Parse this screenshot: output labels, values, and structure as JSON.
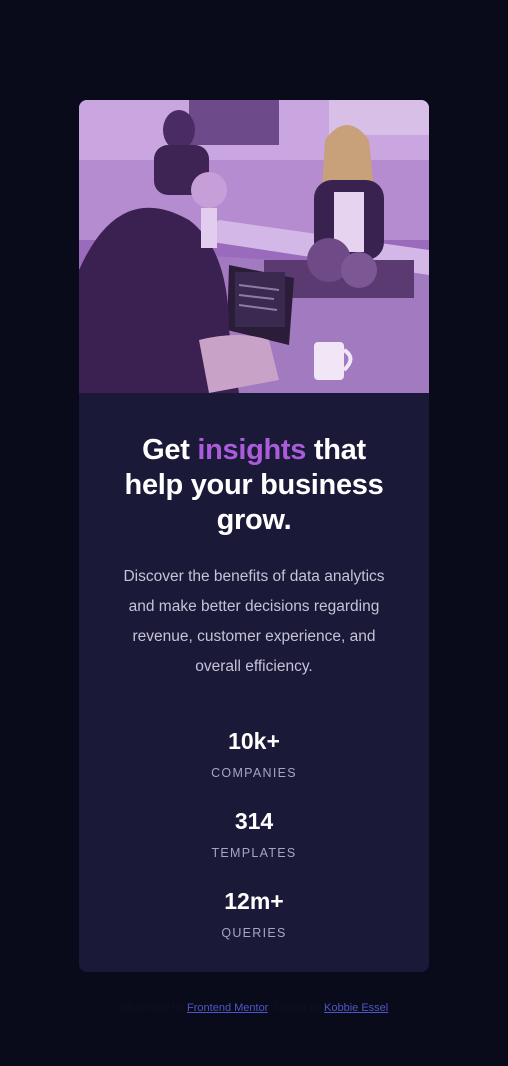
{
  "card": {
    "title_before": "Get ",
    "title_accent": "insights",
    "title_after": " that help your business grow.",
    "description": "Discover the benefits of data analytics and make better decisions regarding revenue, customer experience, and overall efficiency.",
    "stats": [
      {
        "value": "10k+",
        "label": "COMPANIES"
      },
      {
        "value": "314",
        "label": "TEMPLATES"
      },
      {
        "value": "12m+",
        "label": "QUERIES"
      }
    ]
  },
  "attribution": {
    "prefix": "Challenge by ",
    "challenge_link": "Frontend Mentor",
    "middle": ". Coded by ",
    "author_link": "Kobbie Essel"
  },
  "colors": {
    "page_background": "#090b1a",
    "card_background": "#1b1938",
    "accent": "#aa5cdb",
    "image_tint": "#8e5bb0"
  }
}
